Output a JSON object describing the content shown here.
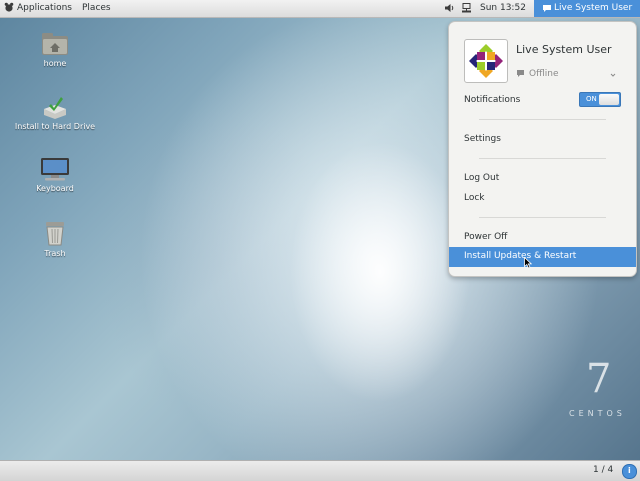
{
  "topbar": {
    "applications_label": "Applications",
    "places_label": "Places",
    "clock": "Sun 13:52",
    "user_label": "Live System User"
  },
  "desktop": {
    "icons": [
      {
        "label": "home",
        "icon": "folder-home-icon"
      },
      {
        "label": "Install to Hard Drive",
        "icon": "install-icon"
      },
      {
        "label": "Keyboard",
        "icon": "keyboard-icon"
      },
      {
        "label": "Trash",
        "icon": "trash-icon"
      }
    ]
  },
  "menu": {
    "user_name": "Live System User",
    "status": "Offline",
    "notifications_label": "Notifications",
    "toggle_on_label": "ON",
    "settings_label": "Settings",
    "logout_label": "Log Out",
    "lock_label": "Lock",
    "poweroff_label": "Power Off",
    "install_updates_label": "Install Updates & Restart"
  },
  "bottombar": {
    "workspace": "1 / 4"
  },
  "watermark": {
    "version": "7",
    "brand": "CENTOS"
  },
  "colors": {
    "accent": "#4a90d9"
  }
}
